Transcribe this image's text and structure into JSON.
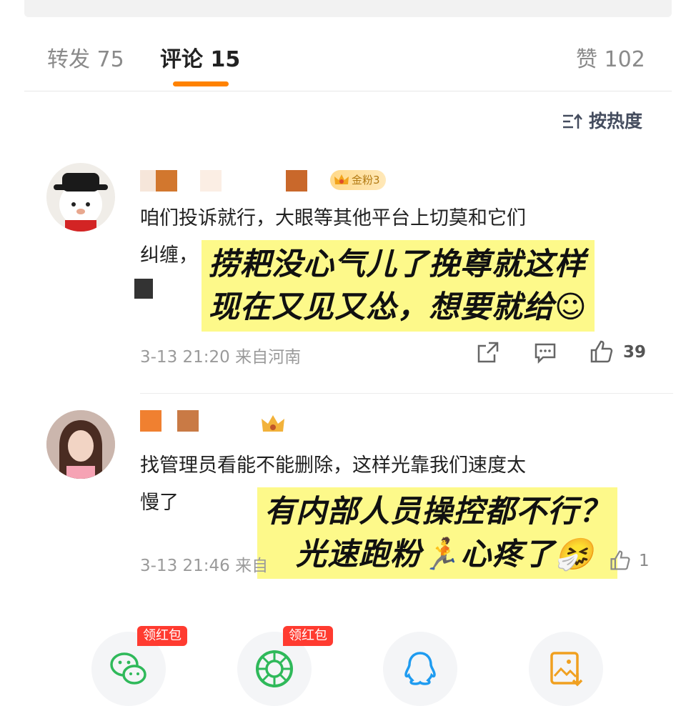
{
  "tabs": {
    "repost": "转发 75",
    "comment": "评论 15",
    "like": "赞 102"
  },
  "sort": {
    "label": "按热度",
    "icon": "sort-icon"
  },
  "comments": [
    {
      "badge": "金粉3",
      "text_lines": [
        "咱们投诉就行，大眼等其他平台上切莫和它们",
        "纠缠，"
      ],
      "meta": "3-13 21:20 来自河南",
      "likes": "39",
      "overlay_lines": [
        "捞耙没心气儿了挽尊就这样",
        "现在又见又怂，想要就给☺"
      ]
    },
    {
      "badge": "",
      "text_lines": [
        "找管理员看能不能删除，这样光靠我们速度太",
        "慢了"
      ],
      "meta": "3-13 21:46 来自",
      "likes": "1",
      "overlay_lines": [
        "有内部人员操控都不行？",
        "光速跑粉🏃心疼了🤧"
      ]
    }
  ],
  "share": {
    "red_packet_1": "领红包",
    "red_packet_2": "领红包",
    "icons": [
      "wechat-icon",
      "moments-icon",
      "qq-icon",
      "save-image-icon"
    ]
  },
  "colors": {
    "accent": "#ff8200",
    "highlight": "#fdf98a",
    "red": "#ff3b30"
  }
}
